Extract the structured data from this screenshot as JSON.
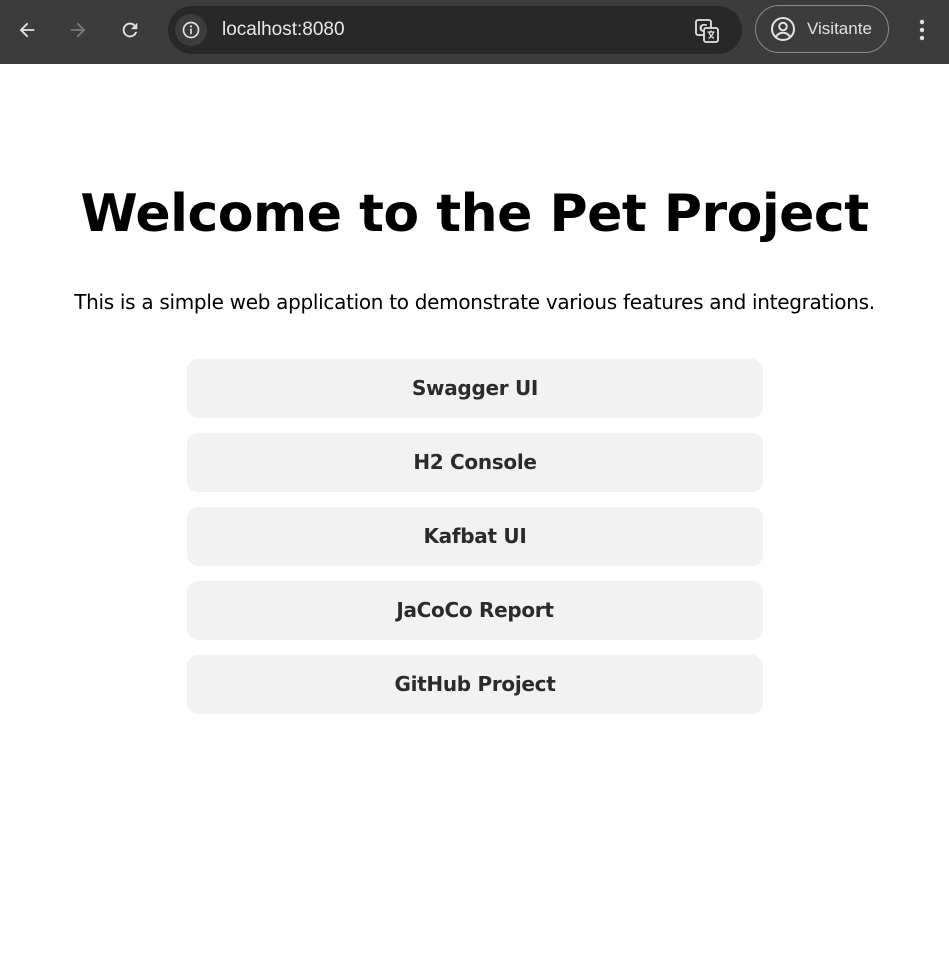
{
  "browser": {
    "url": "localhost:8080",
    "profile_label": "Visitante",
    "colors": {
      "toolbar": "#3c3c3c",
      "omnibox": "#282828",
      "icon": "#e3e3e3",
      "icon_disabled": "#7a7a7a"
    }
  },
  "page": {
    "title": "Welcome to the Pet Project",
    "subtitle": "This is a simple web application to demonstrate various features and integrations.",
    "links": [
      {
        "label": "Swagger UI"
      },
      {
        "label": "H2 Console"
      },
      {
        "label": "Kafbat UI"
      },
      {
        "label": "JaCoCo Report"
      },
      {
        "label": "GitHub Project"
      }
    ],
    "colors": {
      "background": "#ffffff",
      "button_bg": "#f2f2f2",
      "button_text": "#2b2b2b"
    }
  }
}
